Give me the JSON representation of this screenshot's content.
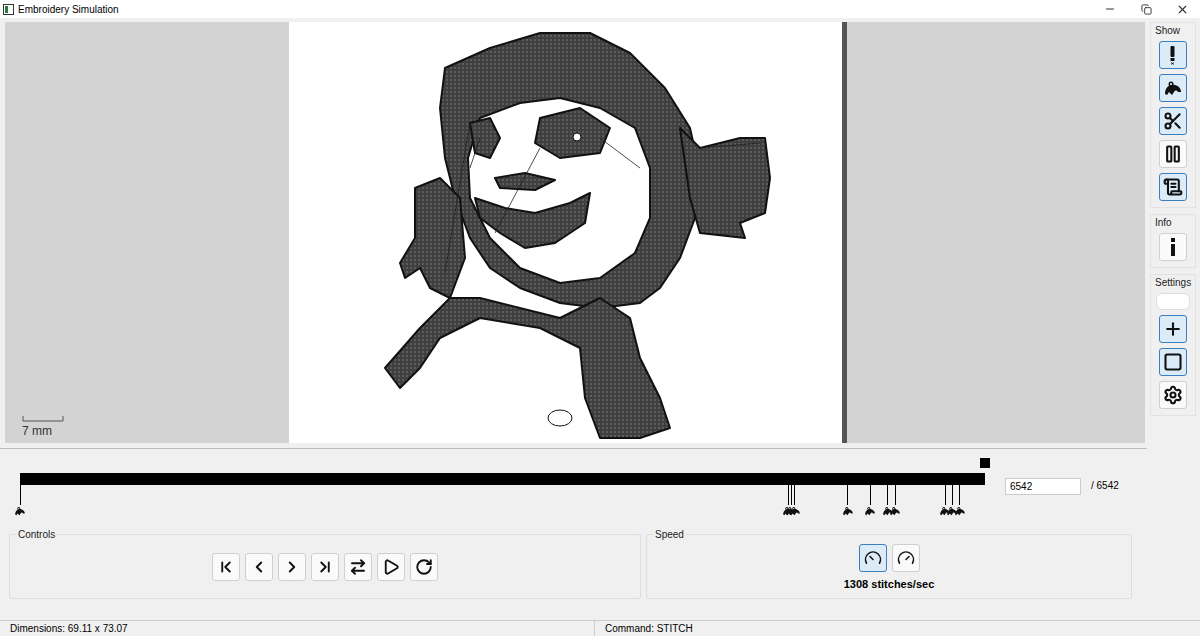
{
  "window": {
    "title": "Embroidery Simulation"
  },
  "canvas": {
    "scale_label": "7 mm"
  },
  "sidebar": {
    "sections": [
      {
        "title": "Show",
        "buttons": [
          {
            "kind": "button",
            "selected": true
          },
          {
            "kind": "button",
            "selected": true
          },
          {
            "kind": "button",
            "selected": true
          },
          {
            "kind": "button",
            "selected": false
          },
          {
            "kind": "button",
            "selected": true
          }
        ]
      },
      {
        "title": "Info",
        "buttons": [
          {
            "kind": "button",
            "selected": false
          }
        ]
      },
      {
        "title": "Settings",
        "buttons": [
          {
            "kind": "field",
            "selected": false
          },
          {
            "kind": "button",
            "selected": true
          },
          {
            "kind": "button",
            "selected": true
          },
          {
            "kind": "button",
            "selected": false
          }
        ]
      }
    ]
  },
  "timeline": {
    "level": 1.0,
    "current": "6542",
    "total": "/ 6542",
    "markers": [
      {
        "level": 0.0
      },
      {
        "level": 0.796
      },
      {
        "level": 0.799
      },
      {
        "level": 0.803
      },
      {
        "level": 0.858
      },
      {
        "level": 0.881
      },
      {
        "level": 0.899
      },
      {
        "level": 0.907
      },
      {
        "level": 0.959
      },
      {
        "level": 0.966
      },
      {
        "level": 0.974
      }
    ]
  },
  "controls": {
    "title": "Controls",
    "buttons": [
      {
        "selected": false
      },
      {
        "selected": false
      },
      {
        "selected": false
      },
      {
        "selected": false
      },
      {
        "selected": false
      },
      {
        "selected": false
      },
      {
        "selected": false
      }
    ]
  },
  "speed": {
    "title": "Speed",
    "buttons": [
      {
        "selected": true
      },
      {
        "selected": false
      }
    ],
    "reading": "1308 stitches/sec"
  },
  "status_bar": {
    "dimensions": "Dimensions: 69.11 x 73.07",
    "command": "Command: STITCH"
  }
}
